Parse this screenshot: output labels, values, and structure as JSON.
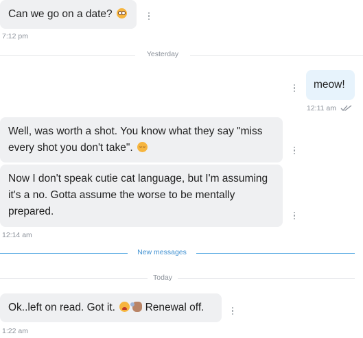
{
  "messages": [
    {
      "text": "Can we go on a date?",
      "emoji": "flushed-face"
    },
    {
      "text": "meow!"
    },
    {
      "text": "Well, was worth a shot. You know what they say \"miss every shot you don't take\".",
      "emoji": "relieved-face"
    },
    {
      "text_lines": [
        "Now I don't speak cutie cat language, but I'm assuming",
        "it's a no. Gotta assume the worse to be mentally",
        "prepared."
      ]
    },
    {
      "text_before": "Ok..left on read. Got it.",
      "emojis": [
        "weary-face",
        "waving-hand"
      ],
      "text_after": "Renewal off."
    }
  ],
  "timestamps": {
    "t1": "7:12 pm",
    "t2": "12:11 am",
    "t3": "12:14 am",
    "t4": "1:22 am"
  },
  "dividers": {
    "yesterday": "Yesterday",
    "new_messages": "New messages",
    "today": "Today"
  },
  "colors": {
    "incoming_bubble": "#eff0f2",
    "outgoing_bubble": "#e7f3fc",
    "new_messages_accent": "#4aa3e0"
  },
  "icons": {
    "more_options": "vertical-dots-icon",
    "read_receipt": "double-check-icon"
  }
}
